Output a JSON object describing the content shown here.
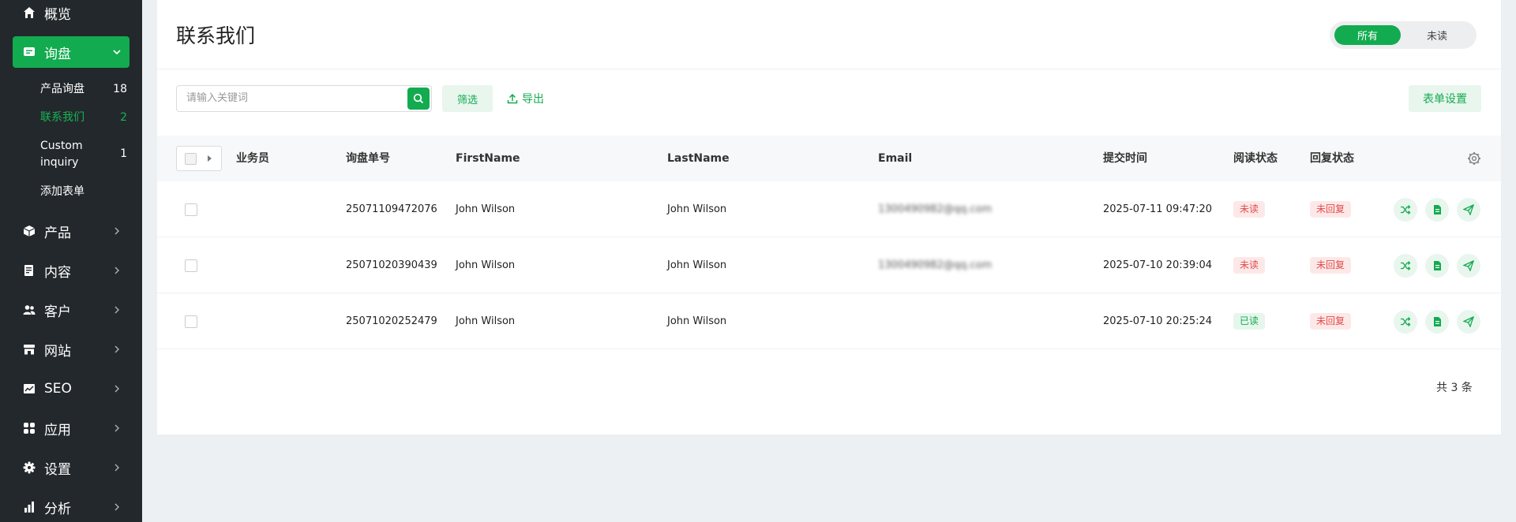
{
  "sidebar": {
    "overview": "概览",
    "inquiry": "询盘",
    "sub_items": [
      {
        "label": "产品询盘",
        "count": "18"
      },
      {
        "label": "联系我们",
        "count": "2"
      },
      {
        "label": "Custom inquiry",
        "count": "1"
      },
      {
        "label": "添加表单",
        "count": ""
      }
    ],
    "items": [
      {
        "label": "产品",
        "icon": "box-icon"
      },
      {
        "label": "内容",
        "icon": "document-icon"
      },
      {
        "label": "客户",
        "icon": "users-icon"
      },
      {
        "label": "网站",
        "icon": "store-icon"
      },
      {
        "label": "SEO",
        "icon": "chart-box-icon"
      },
      {
        "label": "应用",
        "icon": "apps-icon"
      },
      {
        "label": "设置",
        "icon": "gear-icon"
      },
      {
        "label": "分析",
        "icon": "bar-chart-icon"
      }
    ]
  },
  "header": {
    "title": "联系我们",
    "toggle_all": "所有",
    "toggle_unread": "未读"
  },
  "toolbar": {
    "search_placeholder": "请输入关键词",
    "filter": "筛选",
    "export": "导出",
    "form_settings": "表单设置"
  },
  "table": {
    "columns": {
      "salesperson": "业务员",
      "inquiry_no": "询盘单号",
      "first_name": "FirstName",
      "last_name": "LastName",
      "email": "Email",
      "submit_time": "提交时间",
      "read_status": "阅读状态",
      "reply_status": "回复状态"
    },
    "rows": [
      {
        "inquiry_no": "25071109472076",
        "first_name": "John Wilson",
        "last_name": "John Wilson",
        "email": "1300490982@qq.com",
        "submit_time": "2025-07-11 09:47:20",
        "read_status": "未读",
        "reply_status": "未回复"
      },
      {
        "inquiry_no": "25071020390439",
        "first_name": "John Wilson",
        "last_name": "John Wilson",
        "email": "1300490982@qq.com",
        "submit_time": "2025-07-10 20:39:04",
        "read_status": "未读",
        "reply_status": "未回复"
      },
      {
        "inquiry_no": "25071020252479",
        "first_name": "John Wilson",
        "last_name": "John Wilson",
        "email": "",
        "submit_time": "2025-07-10 20:25:24",
        "read_status": "已读",
        "reply_status": "未回复"
      }
    ]
  },
  "footer": {
    "total": "共 3 条"
  },
  "colors": {
    "accent": "#13ab4f",
    "sidebar_bg": "#23282c",
    "unread_red": "#e34b4b"
  }
}
